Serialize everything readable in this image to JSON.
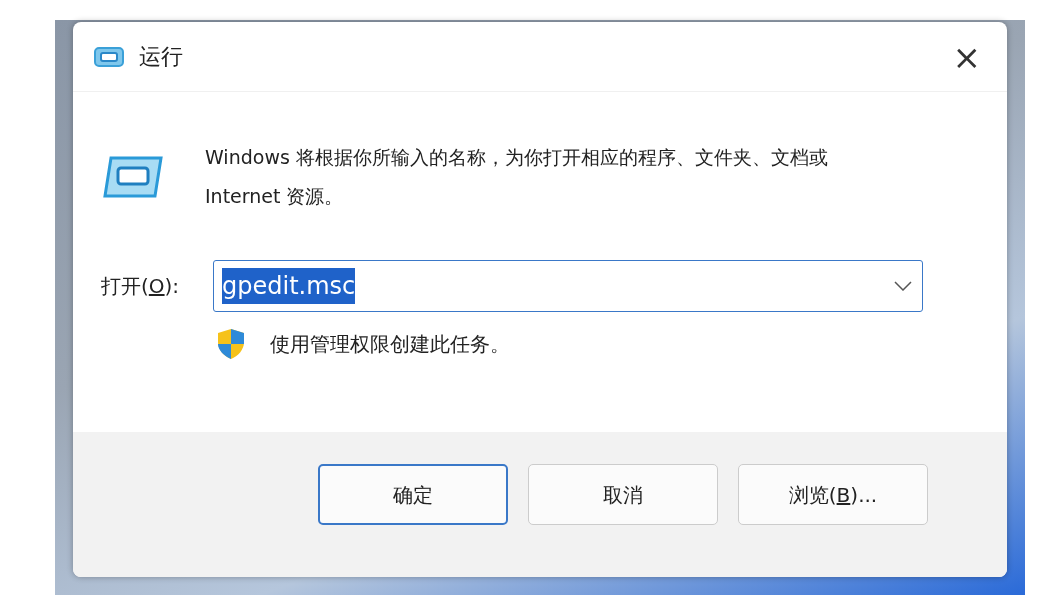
{
  "window": {
    "title": "运行",
    "close_glyph": "×"
  },
  "description": "Windows 将根据你所输入的名称，为你打开相应的程序、文件夹、文档或 Internet 资源。",
  "open_field": {
    "label": {
      "before": "打开(",
      "key": "O",
      "after": "):"
    },
    "value": "gpedit.msc",
    "value_selected": true
  },
  "admin_note": "使用管理权限创建此任务。",
  "buttons": [
    {
      "label": {
        "before": "确定"
      },
      "default": true
    },
    {
      "label": {
        "before": "取消"
      },
      "default": false
    },
    {
      "label": {
        "before": "浏览(",
        "key": "B",
        "after": ")..."
      },
      "default": false
    }
  ]
}
